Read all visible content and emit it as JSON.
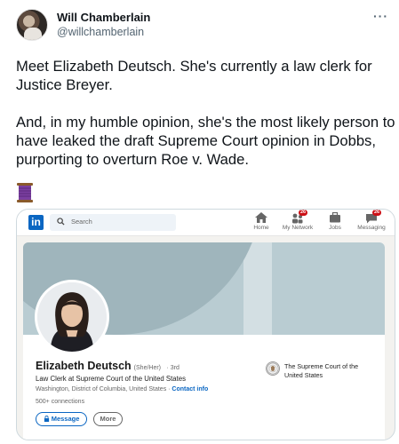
{
  "tweet": {
    "author_name": "Will Chamberlain",
    "author_handle": "@willchamberlain",
    "more_icon": "more-horizontal-icon",
    "paragraph1": "Meet Elizabeth Deutsch. She's currently a law clerk for Justice Breyer.",
    "paragraph2": "And, in my humble opinion, she's the most likely person to have leaked the draft Supreme Court opinion in Dobbs, purporting to overturn Roe v. Wade.",
    "emoji_icon": "thread-spool-icon"
  },
  "linkedin": {
    "logo": "in",
    "search_placeholder": "Search",
    "nav": [
      {
        "label": "Home",
        "icon": "home-icon",
        "badge": ""
      },
      {
        "label": "My Network",
        "icon": "network-icon",
        "badge": "26"
      },
      {
        "label": "Jobs",
        "icon": "briefcase-icon",
        "badge": ""
      },
      {
        "label": "Messaging",
        "icon": "messaging-icon",
        "badge": "26"
      }
    ],
    "profile": {
      "name": "Elizabeth Deutsch",
      "pronouns": "(She/Her)",
      "degree": "· 3rd",
      "headline": "Law Clerk at Supreme Court of the United States",
      "location": "Washington, District of Columbia, United States ·",
      "contact_info": "Contact info",
      "connections": "500+ connections",
      "message_label": "Message",
      "more_label": "More",
      "employer": "The Supreme Court of the United States"
    },
    "colors": {
      "brand": "#0a66c2",
      "badge": "#cc1016",
      "banner": "#b9ccd2"
    }
  }
}
